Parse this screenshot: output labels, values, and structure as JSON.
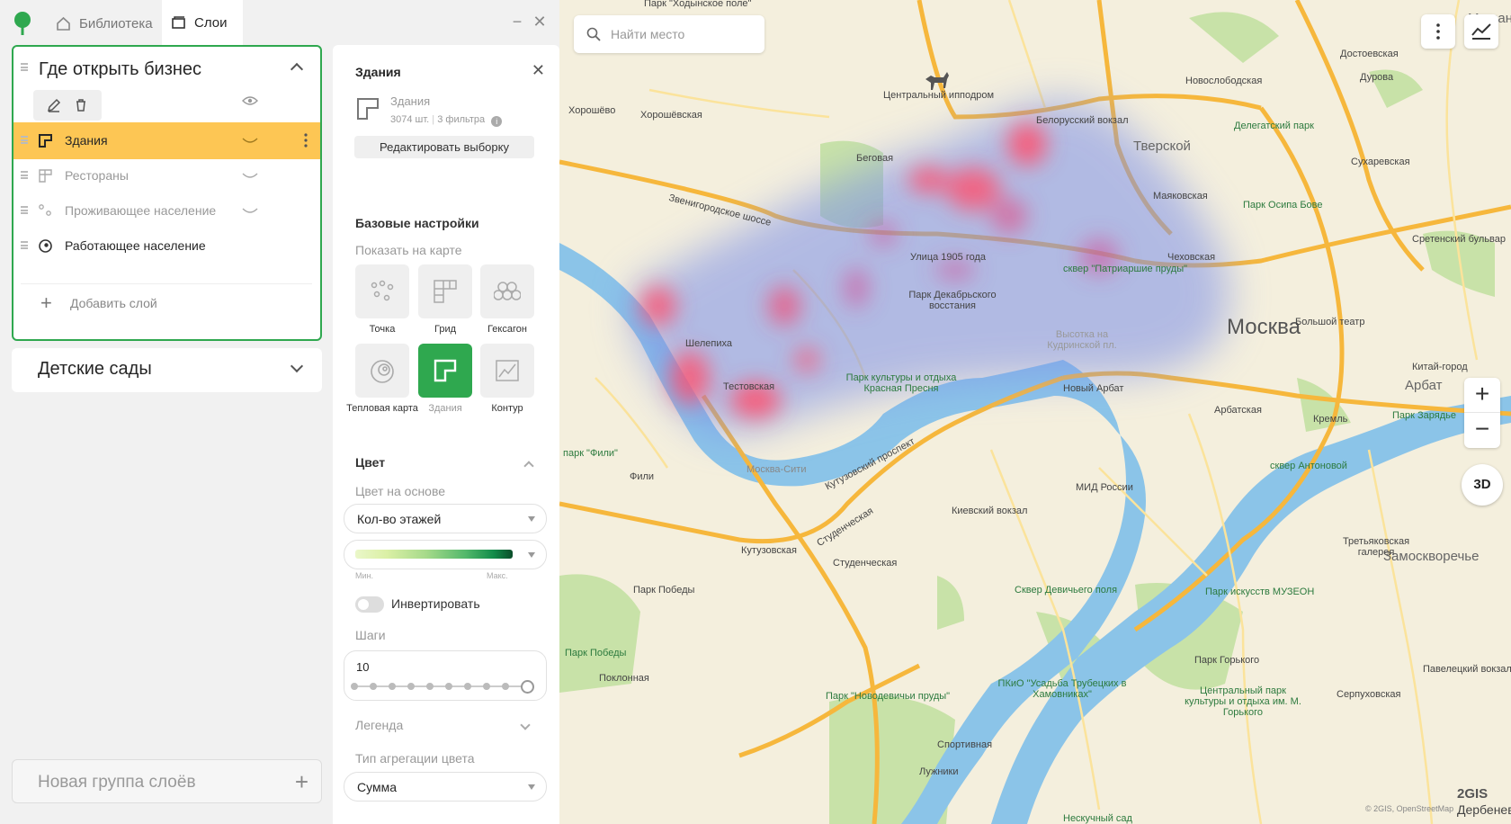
{
  "window": {
    "tabs": [
      {
        "label": "Библиотека",
        "icon": "home-icon",
        "active": false
      },
      {
        "label": "Слои",
        "icon": "layers-icon",
        "active": true
      }
    ]
  },
  "groups": [
    {
      "title": "Где открыть бизнес",
      "expanded": true,
      "layers": [
        {
          "label": "Здания",
          "icon": "building-icon",
          "selected": true,
          "visible": true
        },
        {
          "label": "Рестораны",
          "icon": "grid-icon",
          "selected": false,
          "visible": false
        },
        {
          "label": "Проживающее население",
          "icon": "points-icon",
          "selected": false,
          "visible": false
        },
        {
          "label": "Работающее население",
          "icon": "heatmap-icon",
          "selected": false,
          "visible": true
        }
      ],
      "add_layer_label": "Добавить слой"
    },
    {
      "title": "Детские сады",
      "expanded": false
    }
  ],
  "new_group_label": "Новая группа слоёв",
  "settings": {
    "title": "Здания",
    "selection": {
      "name": "Здания",
      "count": "3074 шт.",
      "filters": "3 фильтра"
    },
    "edit_button": "Редактировать выборку",
    "base_section": "Базовые настройки",
    "show_on_map_label": "Показать на карте",
    "display_types": [
      {
        "label": "Точка",
        "icon": "dots-icon",
        "active": false,
        "enabled": true
      },
      {
        "label": "Грид",
        "icon": "grid-icon",
        "active": false,
        "enabled": true
      },
      {
        "label": "Гексагон",
        "icon": "hexagon-icon",
        "active": false,
        "enabled": true
      },
      {
        "label": "Тепловая карта",
        "icon": "heatmap-icon",
        "active": false,
        "enabled": true
      },
      {
        "label": "Здания",
        "icon": "building-icon",
        "active": true,
        "enabled": false
      },
      {
        "label": "Контур",
        "icon": "contour-icon",
        "active": false,
        "enabled": true
      }
    ],
    "color_section": "Цвет",
    "color_basis_label": "Цвет на основе",
    "color_basis_value": "Кол-во этажей",
    "palette_min": "Мин.",
    "palette_max": "Макс.",
    "invert_label": "Инвертировать",
    "invert_on": false,
    "steps_label": "Шаги",
    "steps_value": "10",
    "legend_label": "Легенда",
    "aggregation_label": "Тип агрегации цвета",
    "aggregation_value": "Сумма"
  },
  "map": {
    "search_placeholder": "Найти место",
    "zoom_in": "+",
    "zoom_out": "−",
    "btn_3d": "3D",
    "brand": "2GIS",
    "attribution": "© 2GIS, OpenStreetMap",
    "labels": {
      "moscow": "Москва",
      "arbat": "Арбат",
      "tverskoy": "Тверской",
      "zamoskvorechye": "Замоскворечье",
      "meshchansky": "Мещанск",
      "hippodrome": "Центральный ипподром",
      "khoroshevo": "Хорошёво",
      "khoroshevskaya": "Хорошёвская",
      "begovaya": "Беговая",
      "zvenigorodskoe": "Звенигородское шоссе",
      "belorussky": "Белорусский вокзал",
      "novoslobodskaya": "Новослободская",
      "dostoevskaya": "Достоевская",
      "durova": "Дурова",
      "delegatsky": "Делегатский парк",
      "sukharevskaya": "Сухаревская",
      "mayakovskaya": "Маяковская",
      "osipa_bove": "Парк Осипа Бове",
      "sretensky": "Сретенский бульвар",
      "chekhovskaya": "Чеховская",
      "patriarshie": "сквер \"Патриаршие пруды\"",
      "bolshoi": "Большой театр",
      "kitay_gorod": "Китай-город",
      "kreml": "Кремль",
      "zaryadye": "Парк Зарядье",
      "ulitsa1905": "Улица 1905 года",
      "dekabr": "Парк Декабрьского восстания",
      "kudrinskaya": "Высотка на Кудринской пл.",
      "shelepikha": "Шелепиха",
      "testovskaya": "Тестовская",
      "krasnaya_presnya": "Парк культуры и отдыха Красная Пресня",
      "moskva_city": "Москва-Сити",
      "novy_arbat": "Новый Арбат",
      "arbatskaya": "Арбатская",
      "antonova": "сквер Антоновой",
      "fili_park": "парк \"Фили\"",
      "fili": "Фили",
      "kutuzovsky": "Кутузовский проспект",
      "mid": "МИД России",
      "kievsky": "Киевский вокзал",
      "kutuzovskaya": "Кутузовская",
      "studencheskaya1": "Студенческая",
      "studencheskaya2": "Студенческая",
      "tretyakovka": "Третьяковская галерея",
      "park_pobedy": "Парк Победы",
      "devichie": "Сквер Девичьего поля",
      "muzeon": "Парк искусств МУЗЕОН",
      "park_pobedy2": "Парк Победы",
      "poklonnaya": "Поклонная",
      "gorky": "Парк Горького",
      "paveletsky": "Павелецкий вокзал",
      "novodevichy": "Парк \"Новодевичьи пруды\"",
      "trubetskih": "ПКиО \"Усадьба Трубецких в Хамовниках\"",
      "central_park": "Центральный парк культуры и отдыха им. М. Горького",
      "serpukhovskaya": "Серпуховская",
      "sportivnaya": "Спортивная",
      "luzhniki": "Лужники",
      "neskuchny": "Нескучный сад",
      "derbenev": "Дербенев",
      "park_khod": "Парк \"Ходынское поле\""
    }
  }
}
